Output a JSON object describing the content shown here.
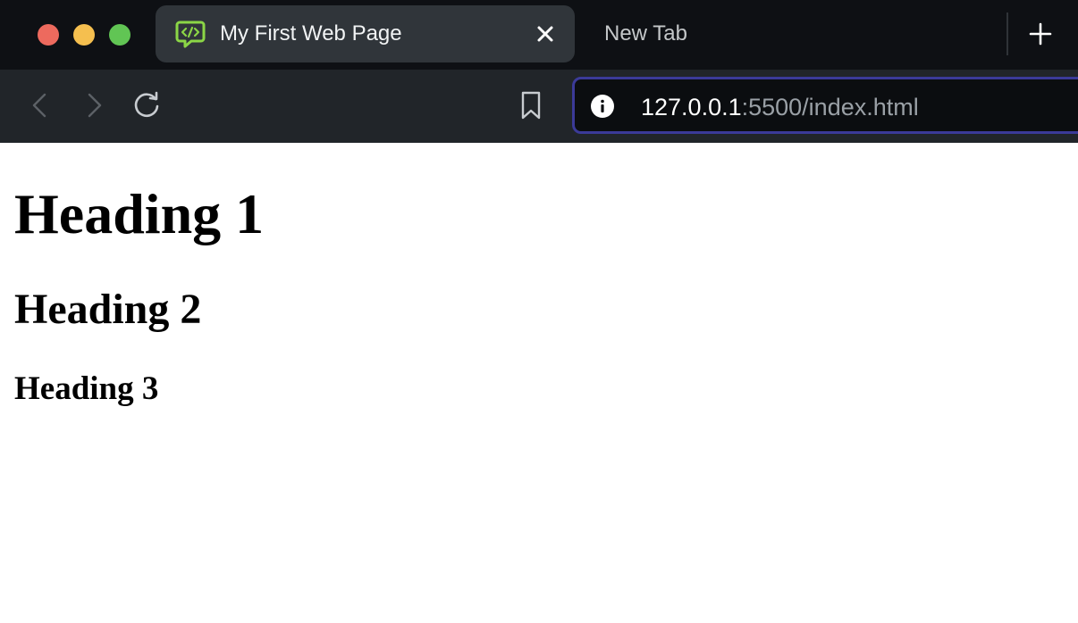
{
  "window": {
    "traffic_lights": {
      "close": "#ed6a5e",
      "minimize": "#f5bf4f",
      "maximize": "#61c554"
    }
  },
  "tabs": [
    {
      "title": "My First Web Page",
      "active": true,
      "favicon": "code-chat-icon",
      "favicon_color": "#8bd646"
    },
    {
      "title": "New Tab",
      "active": false
    }
  ],
  "toolbar": {
    "icons": [
      "back-arrow-icon",
      "forward-arrow-icon",
      "reload-icon",
      "bookmark-icon",
      "info-icon",
      "plus-icon"
    ],
    "address": {
      "host": "127.0.0.1",
      "path": ":5500/index.html",
      "accent": "#3b3a98"
    }
  },
  "page": {
    "heading1": "Heading 1",
    "heading2": "Heading 2",
    "heading3": "Heading 3"
  }
}
